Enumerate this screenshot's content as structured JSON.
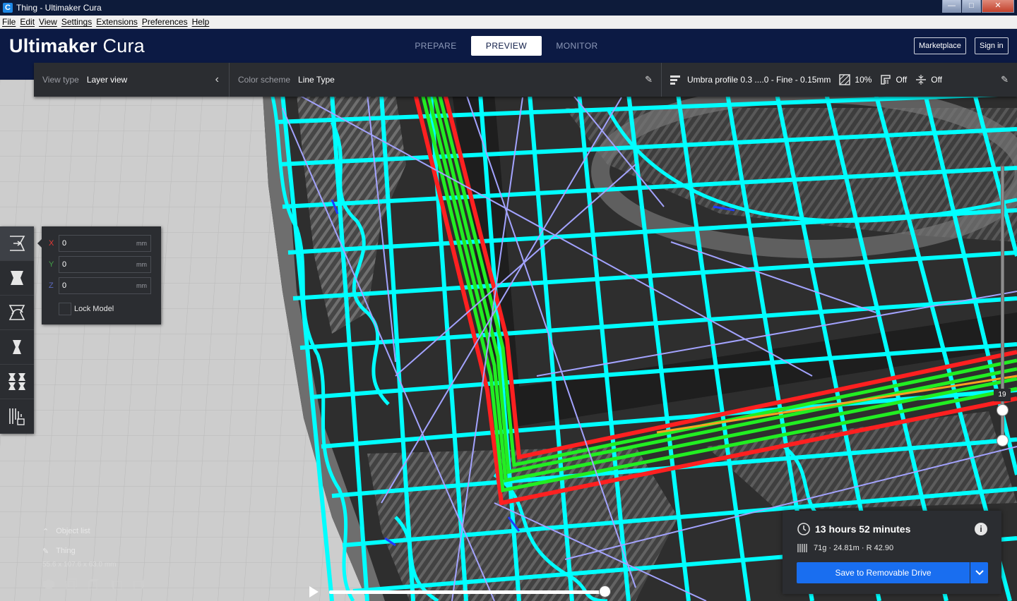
{
  "window": {
    "icon_letter": "C",
    "title": "Thing - Ultimaker Cura",
    "min": "—",
    "max": "□",
    "close": "✕"
  },
  "menu": [
    "File",
    "Edit",
    "View",
    "Settings",
    "Extensions",
    "Preferences",
    "Help"
  ],
  "header": {
    "brand_bold": "Ultimaker",
    "brand_light": " Cura",
    "stages": [
      "PREPARE",
      "PREVIEW",
      "MONITOR"
    ],
    "active_stage": "PREVIEW",
    "marketplace": "Marketplace",
    "sign_in": "Sign in"
  },
  "viewbar": {
    "view_type_label": "View type",
    "view_type_value": "Layer view",
    "color_scheme_label": "Color scheme",
    "color_scheme_value": "Line Type",
    "profile": "Umbra profile 0.3 ....0 - Fine - 0.15mm",
    "infill": "10%",
    "support": "Off",
    "adhesion": "Off"
  },
  "move_panel": {
    "x_label": "X",
    "x_value": "0",
    "y_label": "Y",
    "y_value": "0",
    "z_label": "Z",
    "z_value": "0",
    "unit": "mm",
    "lock_label": "Lock Model",
    "axis_colors": {
      "x": "#e53935",
      "y": "#43a047",
      "z": "#3f51b5"
    }
  },
  "object_list": {
    "title": "Object list",
    "object_name": "Thing",
    "dimensions": "55.6 x 107.6 x 63.0 mm"
  },
  "layer_slider": {
    "current_layer": "19"
  },
  "print_info": {
    "time": "13 hours 52 minutes",
    "material": "71g · 24.81m · R 42.90",
    "save_button": "Save to Removable Drive"
  },
  "icons": [
    "app-icon",
    "back-chevron-icon",
    "pencil-icon",
    "profile-icon",
    "infill-icon",
    "support-icon",
    "adhesion-icon",
    "move-tool-icon",
    "scale-tool-icon",
    "rotate-tool-icon",
    "mirror-tool-icon",
    "per-model-settings-icon",
    "support-blocker-icon",
    "clock-icon",
    "filament-icon",
    "info-icon",
    "chevron-down-icon",
    "play-icon"
  ],
  "colors": {
    "header": "#0c1a44",
    "panel": "#2b2d31",
    "accent": "#196ef0",
    "infill": "#00ffff",
    "outer_wall": "#ff2020",
    "inner_wall": "#22ee22",
    "travel": "#a3a3ff"
  }
}
